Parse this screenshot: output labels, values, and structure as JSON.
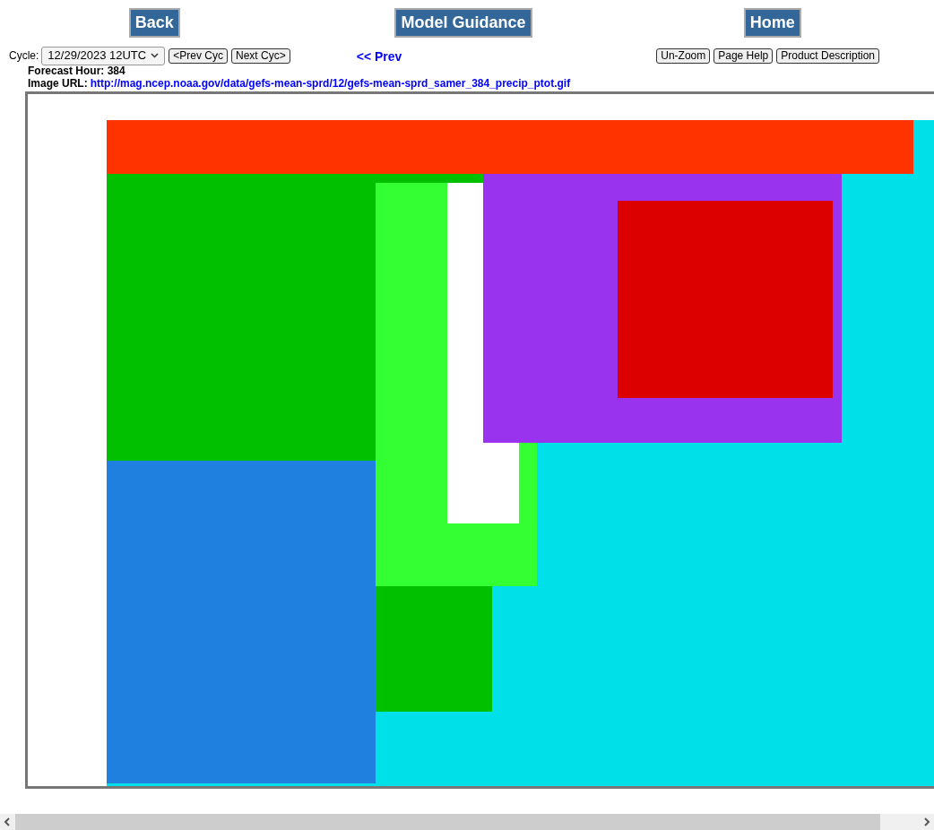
{
  "nav_buttons": [
    "Back",
    "Model Guidance",
    "Home"
  ],
  "cycle": {
    "label": "Cycle:",
    "value": "12/29/2023 12UTC"
  },
  "cycle_buttons": [
    "<Prev Cyc",
    "Next Cyc>"
  ],
  "prev_link": "<< Prev",
  "tool_buttons": [
    "Un-Zoom",
    "Page Help",
    "Product Description"
  ],
  "forecast_hour": "Forecast Hour: 384",
  "image_url": {
    "label": "Image URL:",
    "url": "http://mag.ncep.noaa.gov/data/gefs-mean-sprd/12/gefs-mean-sprd_samer_384_precip_ptot.gif"
  }
}
